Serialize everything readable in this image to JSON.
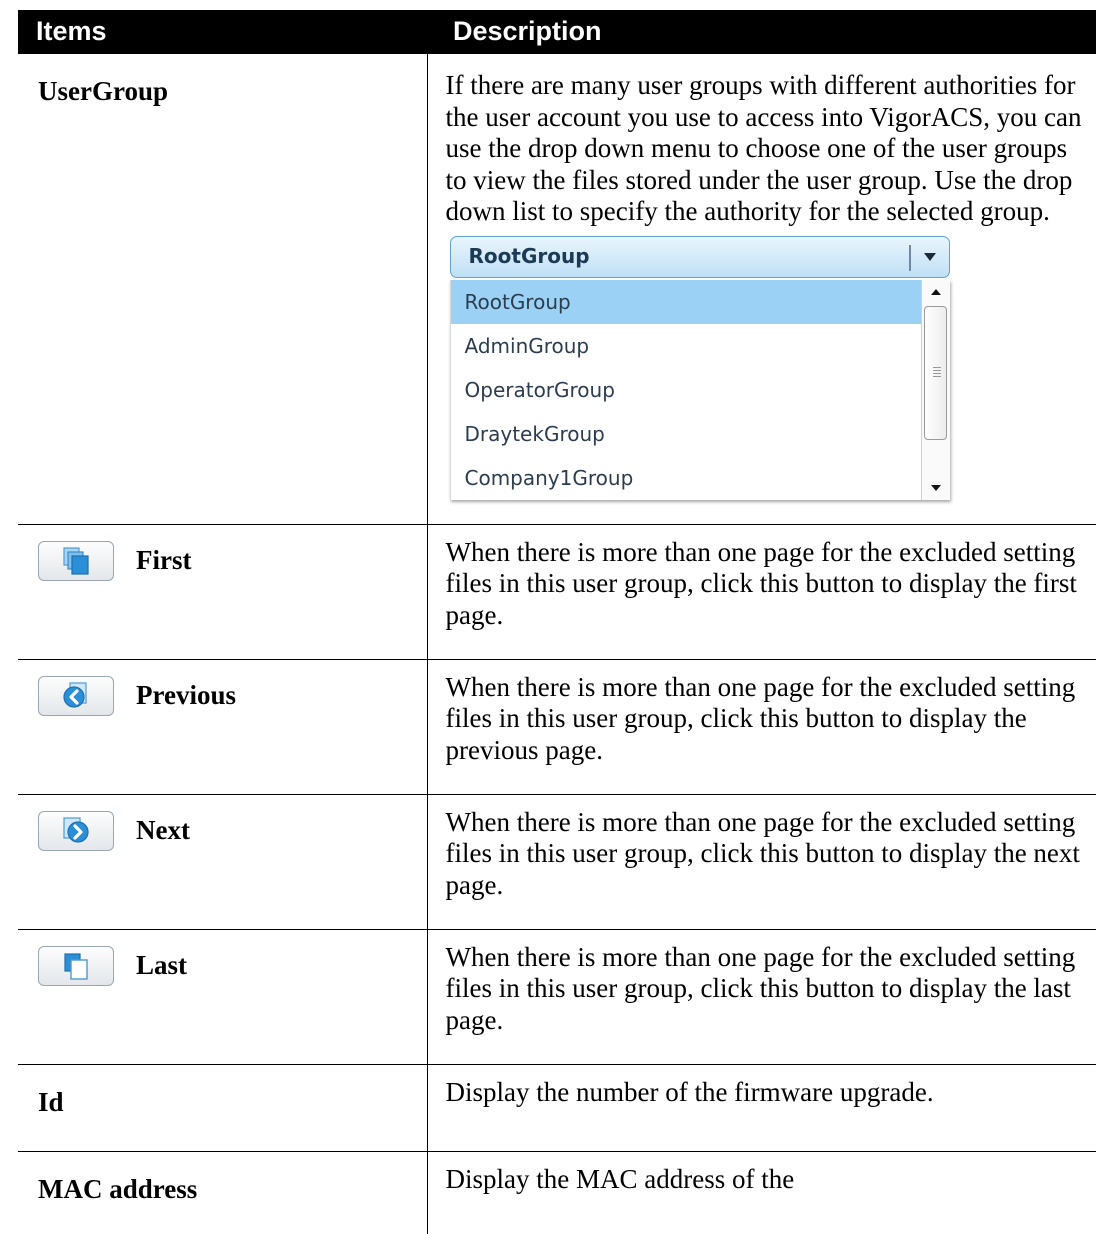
{
  "table": {
    "headers": [
      "Items",
      "Description"
    ],
    "rows": [
      {
        "item": "UserGroup",
        "description": "If there are many user groups with different authorities for the user account you use to access into VigorACS, you can use the drop down menu to choose one of the user groups to view the files stored under the user group. Use the drop down list to specify the authority for the selected group."
      },
      {
        "item": "First",
        "icon": "first-page-icon",
        "description": "When there is more than one page for the excluded setting files in this user group, click this button to display the first page."
      },
      {
        "item": "Previous",
        "icon": "previous-page-icon",
        "description": "When there is more than one page for the excluded setting files in this user group, click this button to display the previous page."
      },
      {
        "item": "Next",
        "icon": "next-page-icon",
        "description": "When there is more than one page for the excluded setting files in this user group, click this button to display the next page."
      },
      {
        "item": "Last",
        "icon": "last-page-icon",
        "description": "When there is more than one page for the excluded setting files in this user group, click this button to display the last page."
      },
      {
        "item": "Id",
        "description": "Display the number of the firmware upgrade."
      },
      {
        "item": "MAC address",
        "description": "Display the MAC address of the"
      }
    ]
  },
  "dropdown": {
    "selected": "RootGroup",
    "options": [
      "RootGroup",
      "AdminGroup",
      "OperatorGroup",
      "DraytekGroup",
      "Company1Group"
    ],
    "highlighted_index": 0
  },
  "colors": {
    "header_bg": "#000000",
    "header_text": "#ffffff",
    "dropdown_accent": "#5ea2d6",
    "option_highlight": "#9cd1f6",
    "button_icon_blue": "#2a8fd6"
  }
}
